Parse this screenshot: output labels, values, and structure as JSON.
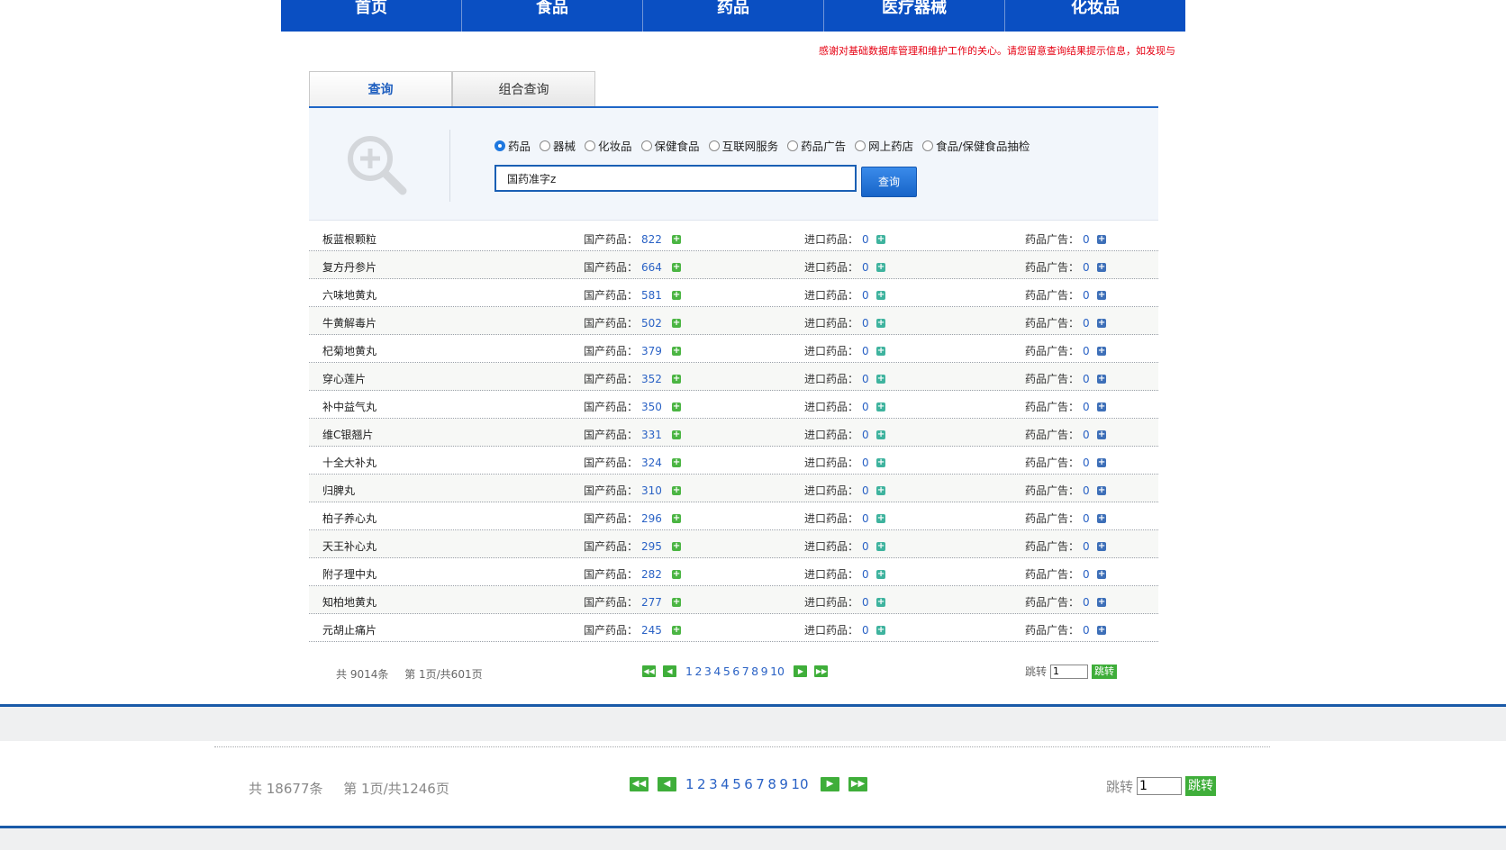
{
  "nav": [
    "首页",
    "食品",
    "药品",
    "医疗器械",
    "化妆品"
  ],
  "notice": "感谢对基础数据库管理和维护工作的关心。请您留意查询结果提示信息，如发现与",
  "tabs": [
    "查询",
    "组合查询"
  ],
  "search": {
    "options": [
      "药品",
      "器械",
      "化妆品",
      "保健食品",
      "互联网服务",
      "药品广告",
      "网上药店",
      "食品/保健食品抽检"
    ],
    "selected": "药品",
    "value": "国药准字z",
    "button": "查询"
  },
  "columns": {
    "domestic": "国产药品：",
    "imported": "进口药品：",
    "ad": "药品广告："
  },
  "rows": [
    {
      "name": "板蓝根颗粒",
      "domestic": "822",
      "imported": "0",
      "ad": "0"
    },
    {
      "name": "复方丹参片",
      "domestic": "664",
      "imported": "0",
      "ad": "0"
    },
    {
      "name": "六味地黄丸",
      "domestic": "581",
      "imported": "0",
      "ad": "0"
    },
    {
      "name": "牛黄解毒片",
      "domestic": "502",
      "imported": "0",
      "ad": "0"
    },
    {
      "name": "杞菊地黄丸",
      "domestic": "379",
      "imported": "0",
      "ad": "0"
    },
    {
      "name": "穿心莲片",
      "domestic": "352",
      "imported": "0",
      "ad": "0"
    },
    {
      "name": "补中益气丸",
      "domestic": "350",
      "imported": "0",
      "ad": "0"
    },
    {
      "name": "维C银翘片",
      "domestic": "331",
      "imported": "0",
      "ad": "0"
    },
    {
      "name": "十全大补丸",
      "domestic": "324",
      "imported": "0",
      "ad": "0"
    },
    {
      "name": "归脾丸",
      "domestic": "310",
      "imported": "0",
      "ad": "0"
    },
    {
      "name": "柏子养心丸",
      "domestic": "296",
      "imported": "0",
      "ad": "0"
    },
    {
      "name": "天王补心丸",
      "domestic": "295",
      "imported": "0",
      "ad": "0"
    },
    {
      "name": "附子理中丸",
      "domestic": "282",
      "imported": "0",
      "ad": "0"
    },
    {
      "name": "知柏地黄丸",
      "domestic": "277",
      "imported": "0",
      "ad": "0"
    },
    {
      "name": "元胡止痛片",
      "domestic": "245",
      "imported": "0",
      "ad": "0"
    }
  ],
  "pager1": {
    "total": "共 9014条",
    "page": "第 1页/共601页",
    "pages": [
      "1",
      "2",
      "3",
      "4",
      "5",
      "6",
      "7",
      "8",
      "9",
      "10"
    ],
    "jump_label": "跳转",
    "jump_value": "1",
    "jump_button": "跳转"
  },
  "pager2": {
    "total": "共 18677条",
    "page": "第 1页/共1246页",
    "pages": [
      "1",
      "2",
      "3",
      "4",
      "5",
      "6",
      "7",
      "8",
      "9",
      "10"
    ],
    "jump_label": "跳转",
    "jump_value": "1",
    "jump_button": "跳转"
  },
  "colors": {
    "nav_bg": "#0a4fc2",
    "accent_blue": "#1f66c7",
    "notice_red": "#e60012",
    "pager_green": "#3fae3a"
  },
  "icons": {
    "magnifier": "zoom-in-icon",
    "first": "first-page-icon",
    "prev": "prev-page-icon",
    "next": "next-page-icon",
    "last": "last-page-icon",
    "expand": "plus-icon"
  }
}
